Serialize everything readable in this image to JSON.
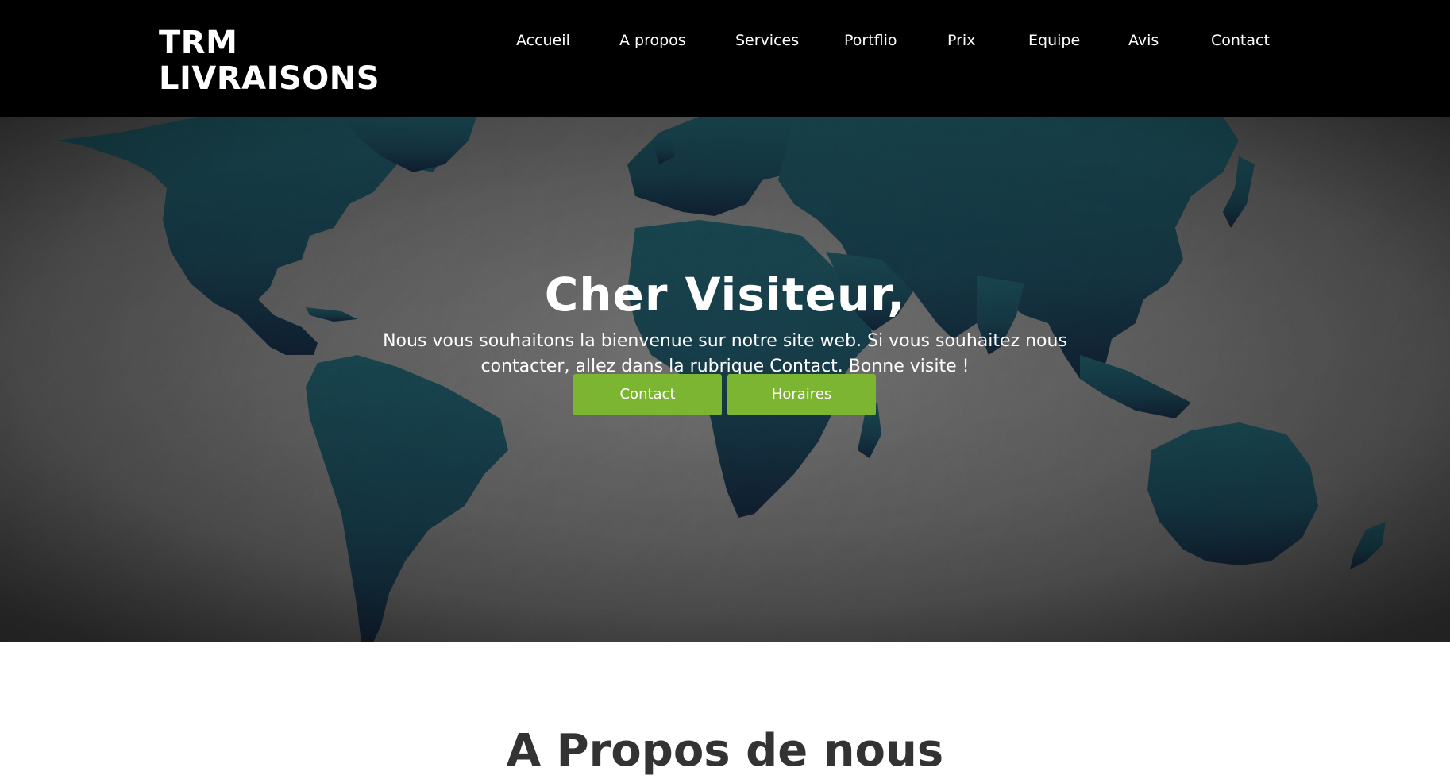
{
  "header": {
    "brand_line1": "TRM",
    "brand_line2": "LIVRAISONS",
    "nav": [
      {
        "label": "Accueil"
      },
      {
        "label": "A propos"
      },
      {
        "label": "Services"
      },
      {
        "label": "Portflio"
      },
      {
        "label": "Prix"
      },
      {
        "label": "Equipe"
      },
      {
        "label": "Avis"
      },
      {
        "label": "Contact"
      }
    ]
  },
  "hero": {
    "title": "Cher Visiteur,",
    "subtitle": "Nous vous souhaitons la bienvenue sur notre site web. Si vous souhaitez nous contacter, allez dans la rubrique Contact. Bonne visite !",
    "buttons": {
      "contact": "Contact",
      "horaires": "Horaires"
    },
    "background_image": "world-map-crumpled-paper"
  },
  "about": {
    "heading": "A Propos de nous"
  },
  "colors": {
    "header_bg": "#000000",
    "accent_button": "#7cb531",
    "map_land": "#1d4f5c",
    "map_paper": "#7d7d7d",
    "text_light": "#ffffff",
    "heading_dark": "#333333"
  }
}
